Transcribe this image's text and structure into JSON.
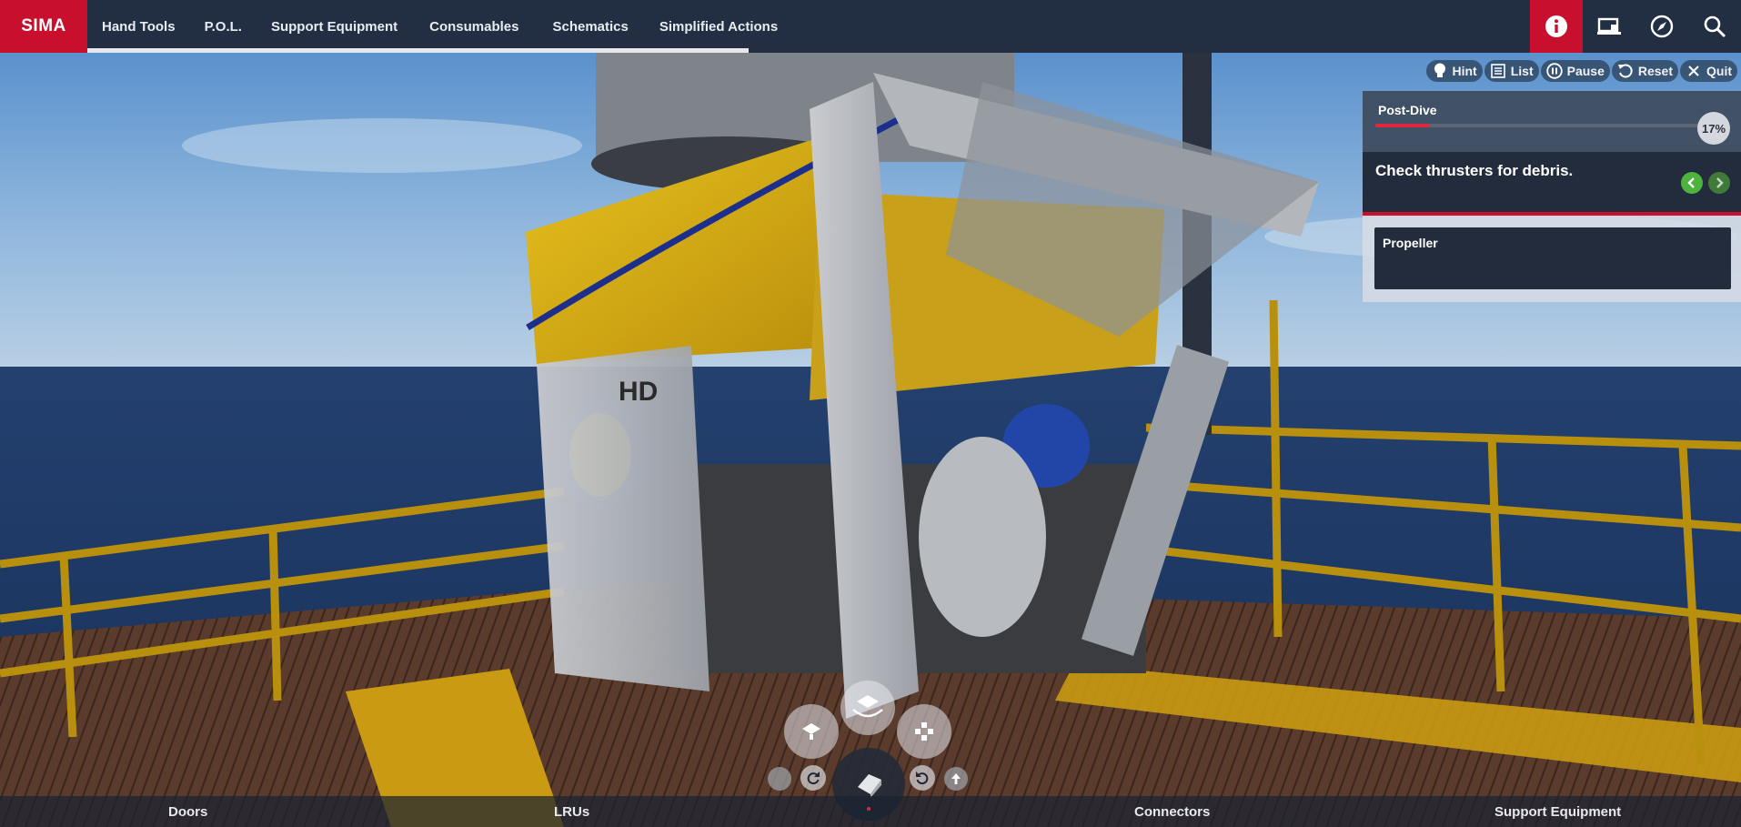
{
  "app": {
    "brand": "SIMA"
  },
  "nav": {
    "items": [
      {
        "label": "Hand Tools"
      },
      {
        "label": "P.O.L."
      },
      {
        "label": "Support Equipment"
      },
      {
        "label": "Consumables"
      },
      {
        "label": "Schematics"
      },
      {
        "label": "Simplified Actions"
      }
    ]
  },
  "top_icons": [
    "info-icon",
    "screen-icon",
    "compass-icon",
    "search-icon"
  ],
  "controls": {
    "hint": "Hint",
    "list": "List",
    "pause": "Pause",
    "reset": "Reset",
    "quit": "Quit"
  },
  "task": {
    "phase": "Post-Dive",
    "progress_percent": 17,
    "progress_label": "17%",
    "step": "Check thrusters for debris.",
    "target": "Propeller"
  },
  "bottom": {
    "tabs": [
      {
        "label": "Doors"
      },
      {
        "label": "LRUs"
      },
      {
        "label": "Connectors"
      },
      {
        "label": "Support Equipment"
      }
    ]
  },
  "colors": {
    "brand": "#c8102e",
    "accent_green": "#4db33d",
    "topbar": "#1e2636"
  }
}
